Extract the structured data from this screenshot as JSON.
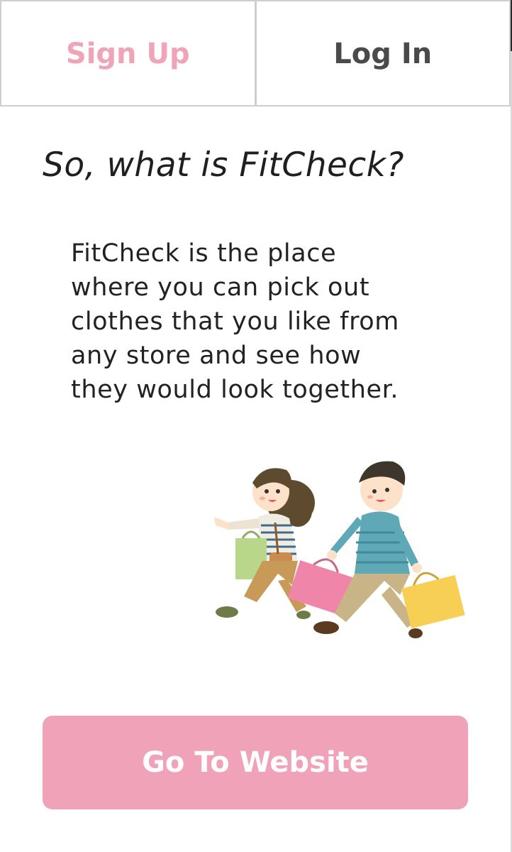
{
  "tabs": {
    "signup_label": "Sign Up",
    "login_label": "Log In"
  },
  "content": {
    "headline": "So, what is FitCheck?",
    "description": "FitCheck is the place where you can pick out clothes that you like from any store and see how they would look together."
  },
  "cta": {
    "label": "Go To Website"
  },
  "colors": {
    "accent_pink": "#f0a3b8",
    "text_dark": "#222222",
    "tab_inactive": "#4a4a4a"
  }
}
